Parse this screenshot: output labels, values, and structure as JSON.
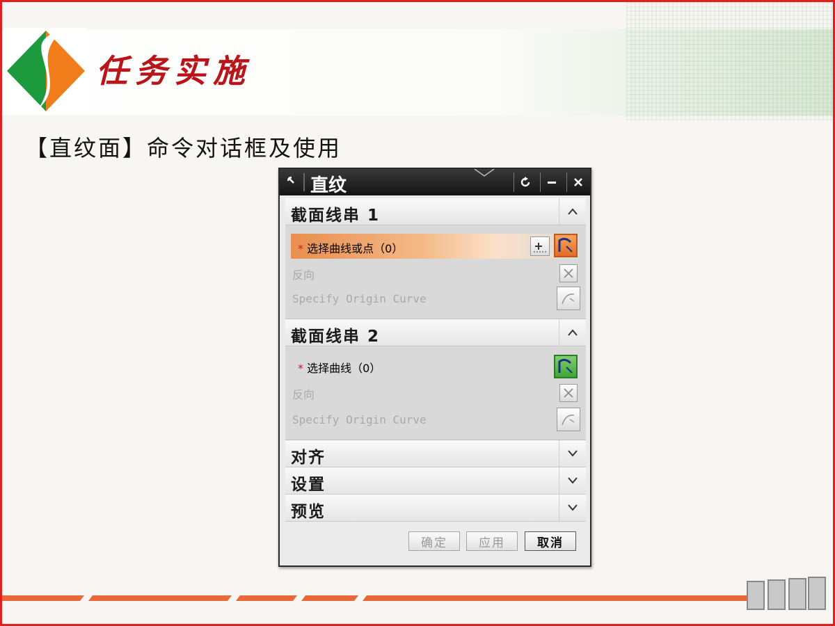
{
  "slide": {
    "title": "任务实施",
    "subtitle": "【直纹面】命令对话框及使用"
  },
  "dialog": {
    "title": "直纹",
    "sections": {
      "s1": {
        "label": "截面线串 1",
        "select": "选择曲线或点（0）",
        "reverse": "反向",
        "origin": "Specify Origin Curve"
      },
      "s2": {
        "label": "截面线串 2",
        "select": "选择曲线（0）",
        "reverse": "反向",
        "origin": "Specify Origin Curve"
      },
      "align": {
        "label": "对齐"
      },
      "settings": {
        "label": "设置"
      },
      "preview": {
        "label": "预览"
      }
    },
    "buttons": {
      "ok": "确定",
      "apply": "应用",
      "cancel": "取消"
    }
  },
  "colors": {
    "accent_red": "#b8141a",
    "border_red": "#e0201e",
    "highlight_orange": "#e98e4e",
    "select_active_green": "#53b849"
  }
}
